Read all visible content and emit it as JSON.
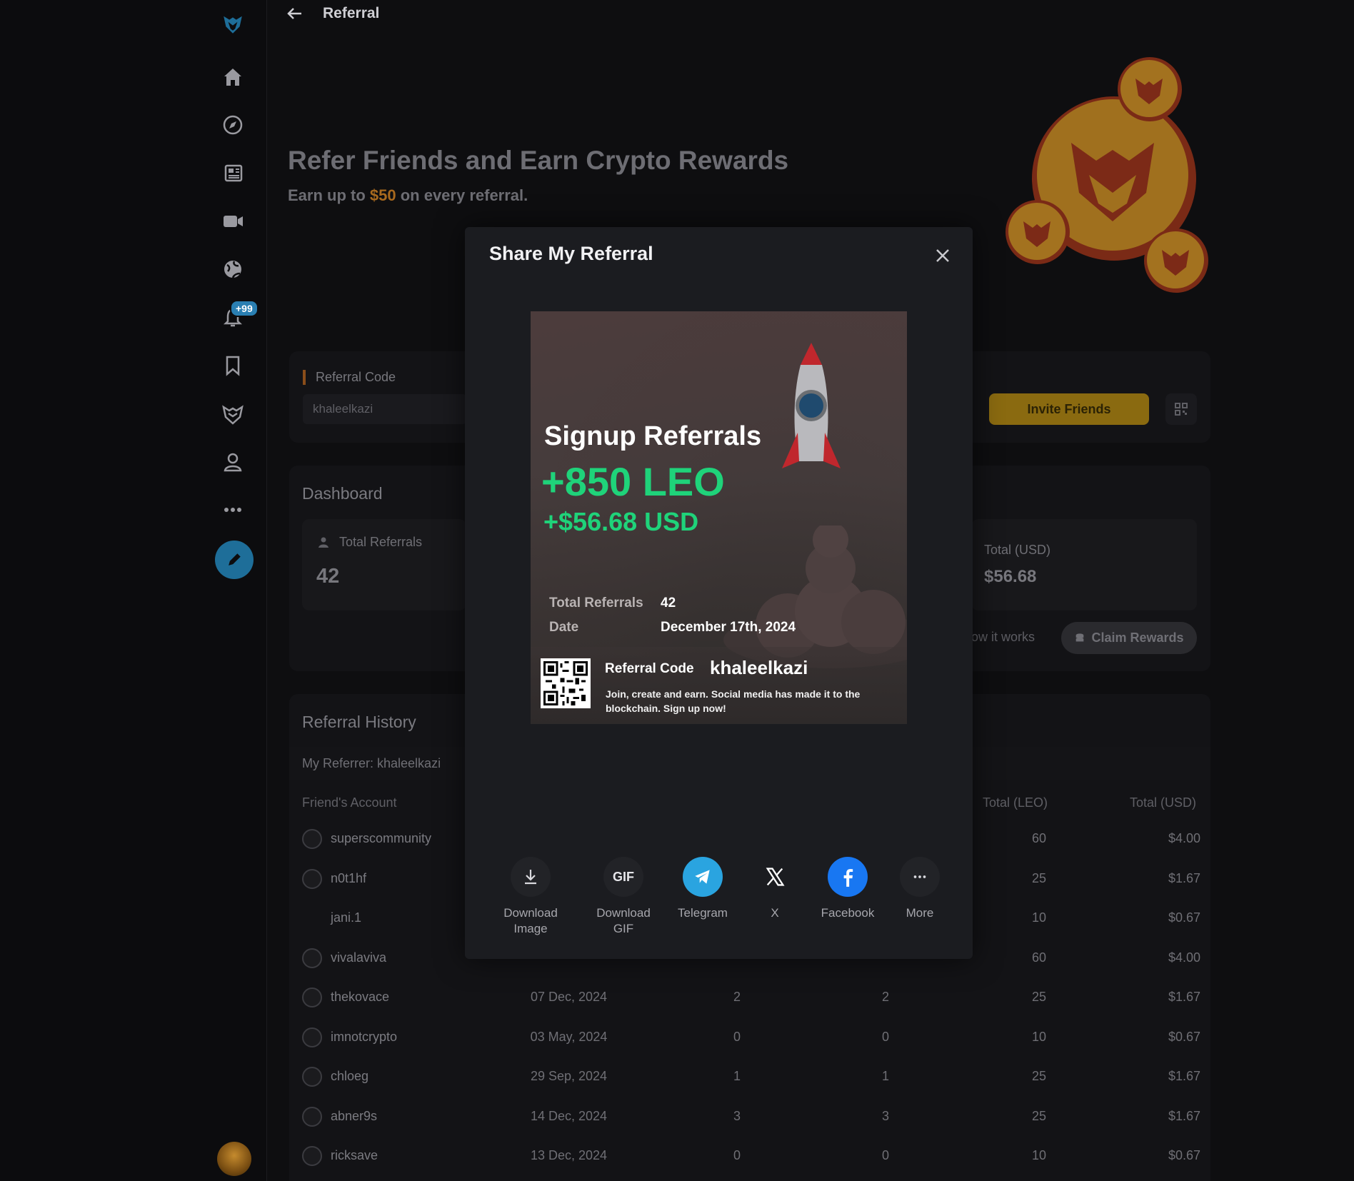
{
  "topbar": {
    "title": "Referral"
  },
  "sidebar": {
    "notification_badge": "+99"
  },
  "hero": {
    "title": "Refer Friends and Earn Crypto Rewards",
    "subtitle_prefix": "Earn up to ",
    "subtitle_amount": "$50",
    "subtitle_suffix": " on every referral."
  },
  "referral": {
    "label": "Referral Code",
    "code": "khaleelkazi",
    "invite_label": "Invite Friends"
  },
  "dashboard": {
    "title": "Dashboard",
    "total_referrals_label": "Total Referrals",
    "total_referrals_value": "42",
    "total_usd_label": "Total (USD)",
    "total_usd_value": "$56.68",
    "how_it_works": "ow it works",
    "claim_label": "Claim Rewards"
  },
  "history": {
    "title": "Referral History",
    "my_referrer": "My Referrer: khaleelkazi",
    "columns": {
      "account": "Friend's Account",
      "leo": "Total (LEO)",
      "usd": "Total (USD)"
    },
    "rows": [
      {
        "name": "superscommunity",
        "date": "",
        "a": "",
        "b": "",
        "leo": "60",
        "usd": "$4.00"
      },
      {
        "name": "n0t1hf",
        "date": "",
        "a": "",
        "b": "",
        "leo": "25",
        "usd": "$1.67"
      },
      {
        "name": "jani.1",
        "date": "",
        "a": "",
        "b": "",
        "leo": "10",
        "usd": "$0.67"
      },
      {
        "name": "vivalaviva",
        "date": "",
        "a": "",
        "b": "",
        "leo": "60",
        "usd": "$4.00"
      },
      {
        "name": "thekovace",
        "date": "07 Dec, 2024",
        "a": "2",
        "b": "2",
        "leo": "25",
        "usd": "$1.67"
      },
      {
        "name": "imnotcrypto",
        "date": "03 May, 2024",
        "a": "0",
        "b": "0",
        "leo": "10",
        "usd": "$0.67"
      },
      {
        "name": "chloeg",
        "date": "29 Sep, 2024",
        "a": "1",
        "b": "1",
        "leo": "25",
        "usd": "$1.67"
      },
      {
        "name": "abner9s",
        "date": "14 Dec, 2024",
        "a": "3",
        "b": "3",
        "leo": "25",
        "usd": "$1.67"
      },
      {
        "name": "ricksave",
        "date": "13 Dec, 2024",
        "a": "0",
        "b": "0",
        "leo": "10",
        "usd": "$0.67"
      }
    ]
  },
  "modal": {
    "title": "Share My Referral",
    "card": {
      "title": "Signup Referrals",
      "leo": "+850 LEO",
      "usd": "+$56.68 USD",
      "total_referrals_label": "Total Referrals",
      "total_referrals_value": "42",
      "date_label": "Date",
      "date_value": "December 17th, 2024",
      "code_label": "Referral Code",
      "code_value": "khaleelkazi",
      "description": "Join, create and earn. Social media has made it to the blockchain. Sign up now!"
    },
    "share_buttons": [
      {
        "label": "Download Image",
        "icon": "download-icon"
      },
      {
        "label": "Download GIF",
        "icon": "gif-icon",
        "icon_text": "GIF"
      },
      {
        "label": "Telegram",
        "icon": "telegram-icon"
      },
      {
        "label": "X",
        "icon": "x-icon"
      },
      {
        "label": "Facebook",
        "icon": "facebook-icon"
      },
      {
        "label": "More",
        "icon": "more-icon"
      }
    ]
  },
  "colors": {
    "accent_green": "#1fd37a",
    "telegram": "#2aa4e0",
    "facebook": "#1877f2",
    "invite": "#8a6a10"
  }
}
